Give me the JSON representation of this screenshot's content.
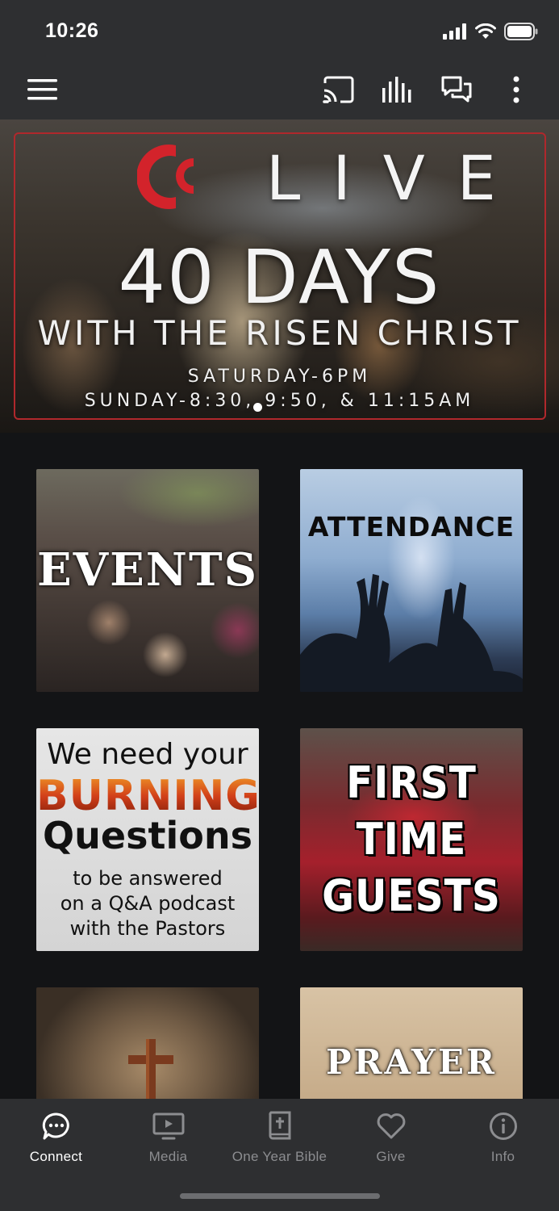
{
  "status_bar": {
    "time": "10:26"
  },
  "toolbar": {
    "menu_icon": "hamburger-menu-icon",
    "cast_icon": "cast-icon",
    "audio_icon": "audio-bars-icon",
    "chat_icon": "chat-bubbles-icon",
    "more_icon": "more-vertical-icon"
  },
  "hero": {
    "live": "LIVE",
    "title": "40 DAYS",
    "subtitle": "WITH THE RISEN CHRIST",
    "times_line1": "SATURDAY-6PM",
    "times_line2": "SUNDAY-8:30, 9:50, & 11:15AM",
    "frame_color": "#b0282c",
    "logo_color": "#d3232b"
  },
  "tiles": {
    "events": {
      "label": "EVENTS"
    },
    "attendance": {
      "label": "ATTENDANCE"
    },
    "burning": {
      "line1": "We need your",
      "line2": "BURNING",
      "line3": "Questions",
      "line4": "to be answered",
      "line5": "on a Q&A podcast",
      "line6": "with the Pastors"
    },
    "first_time": {
      "line1": "FIRST",
      "line2": "TIME",
      "line3": "GUESTS"
    },
    "cross": {
      "icon": "cross-icon"
    },
    "prayer": {
      "label": "PRAYER"
    }
  },
  "bottom_nav": {
    "items": [
      {
        "label": "Connect",
        "icon": "chat-bubble-icon",
        "active": true
      },
      {
        "label": "Media",
        "icon": "tv-play-icon",
        "active": false
      },
      {
        "label": "One Year Bible",
        "icon": "bible-icon",
        "active": false
      },
      {
        "label": "Give",
        "icon": "heart-icon",
        "active": false
      },
      {
        "label": "Info",
        "icon": "info-icon",
        "active": false
      }
    ]
  }
}
